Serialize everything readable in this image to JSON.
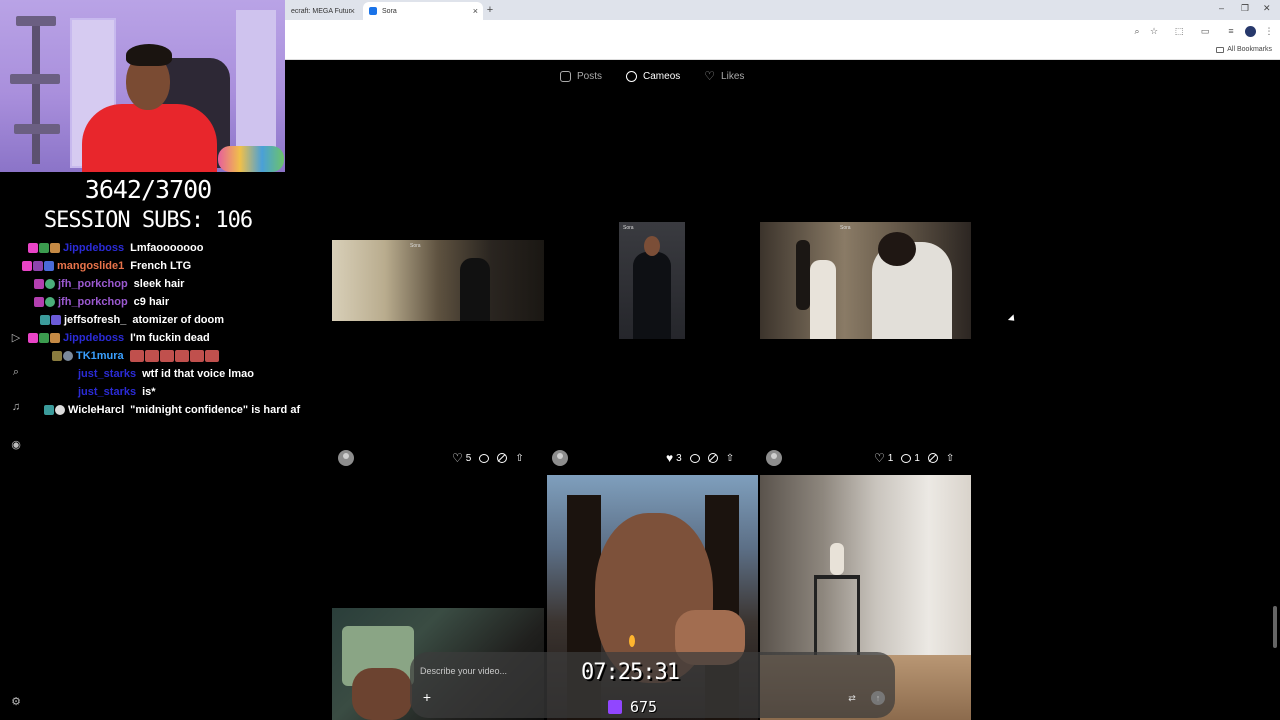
{
  "browser": {
    "tabs": [
      {
        "label": "ecraft: MEGA Futur"
      },
      {
        "label": "Sora"
      }
    ],
    "bookmarks_label": "All Bookmarks"
  },
  "stream": {
    "counter": "3642/3700",
    "session_subs": "SESSION SUBS: 106",
    "timer": "07:25:31",
    "viewers": "675"
  },
  "chat": [
    {
      "user": "Jippdeboss",
      "color": "#2b2bd6",
      "message": "Lmfaooooooo"
    },
    {
      "user": "mangoslide1",
      "color": "#e8734a",
      "message": "French LTG"
    },
    {
      "user": "jfh_porkchop",
      "color": "#9b59d0",
      "message": "sleek hair"
    },
    {
      "user": "jfh_porkchop",
      "color": "#9b59d0",
      "message": "c9 hair"
    },
    {
      "user": "jeffsofresh_",
      "color": "#ffffff",
      "message": "atomizer of doom"
    },
    {
      "user": "Jippdeboss",
      "color": "#2b2bd6",
      "message": "I'm fuckin dead"
    },
    {
      "user": "TK1mura",
      "color": "#3aa0ff",
      "message": ""
    },
    {
      "user": "just_starks",
      "color": "#2b2bd6",
      "message": "wtf id that voice lmao"
    },
    {
      "user": "just_starks",
      "color": "#2b2bd6",
      "message": "is*"
    },
    {
      "user": "WicleHarcl",
      "color": "#ffffff",
      "message": "\"midnight confidence\" is hard af"
    }
  ],
  "sora": {
    "tabs": [
      {
        "label": "Posts",
        "icon": "play-square-icon"
      },
      {
        "label": "Cameos",
        "icon": "user-circle-icon"
      },
      {
        "label": "Likes",
        "icon": "heart-icon"
      }
    ],
    "active_tab": "Cameos",
    "watermark": "Sora",
    "posts": [
      {
        "likes": "5",
        "comments": ""
      },
      {
        "likes": "3",
        "comments": ""
      },
      {
        "likes": "1",
        "comments": "1"
      }
    ],
    "prompt": {
      "placeholder": "Describe your video..."
    }
  }
}
